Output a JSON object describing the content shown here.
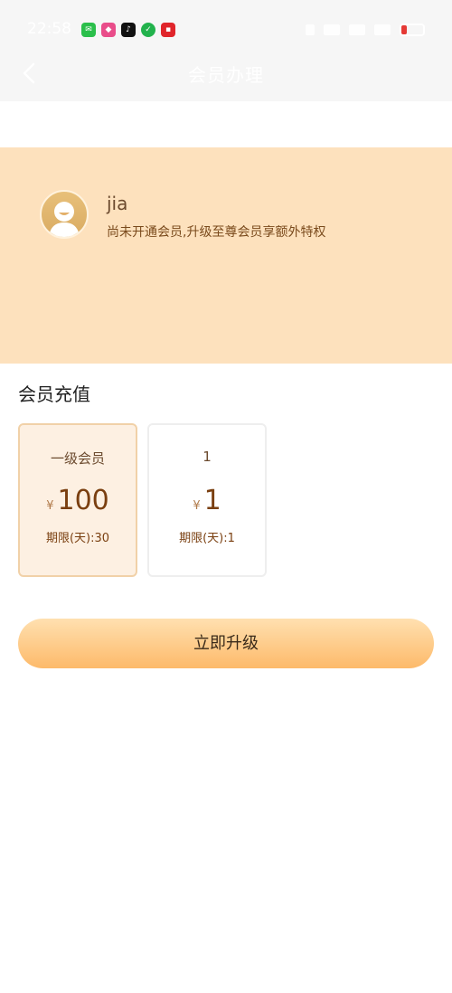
{
  "status_bar": {
    "time": "22:58",
    "apps": [
      {
        "icon": "wechat-icon",
        "color": "#2bbf4b"
      },
      {
        "icon": "shopping-app-icon",
        "color": "#e94d8a"
      },
      {
        "icon": "tiktok-icon",
        "color": "#111111"
      },
      {
        "icon": "security-shield-icon",
        "color": "#22b24c"
      },
      {
        "icon": "tmall-11-11-icon",
        "color": "#e0252b"
      }
    ],
    "battery_level": 0.25
  },
  "nav": {
    "back_icon": "chevron-left-icon",
    "title": "会员办理"
  },
  "user": {
    "avatar_icon": "default-avatar-icon",
    "name": "jia",
    "description": "尚未开通会员,升级至尊会员享额外特权"
  },
  "section": {
    "title": "会员充值"
  },
  "plans": [
    {
      "name": "一级会员",
      "currency": "¥",
      "amount": "100",
      "period": "期限(天):30",
      "selected": true
    },
    {
      "name": "1",
      "currency": "¥",
      "amount": "1",
      "period": "期限(天):1",
      "selected": false
    }
  ],
  "actions": {
    "upgrade_label": "立即升级"
  },
  "colors": {
    "card_background": "#fde1bd",
    "accent": "#fdba6a",
    "selected_plan_background": "#fdf0e2"
  }
}
